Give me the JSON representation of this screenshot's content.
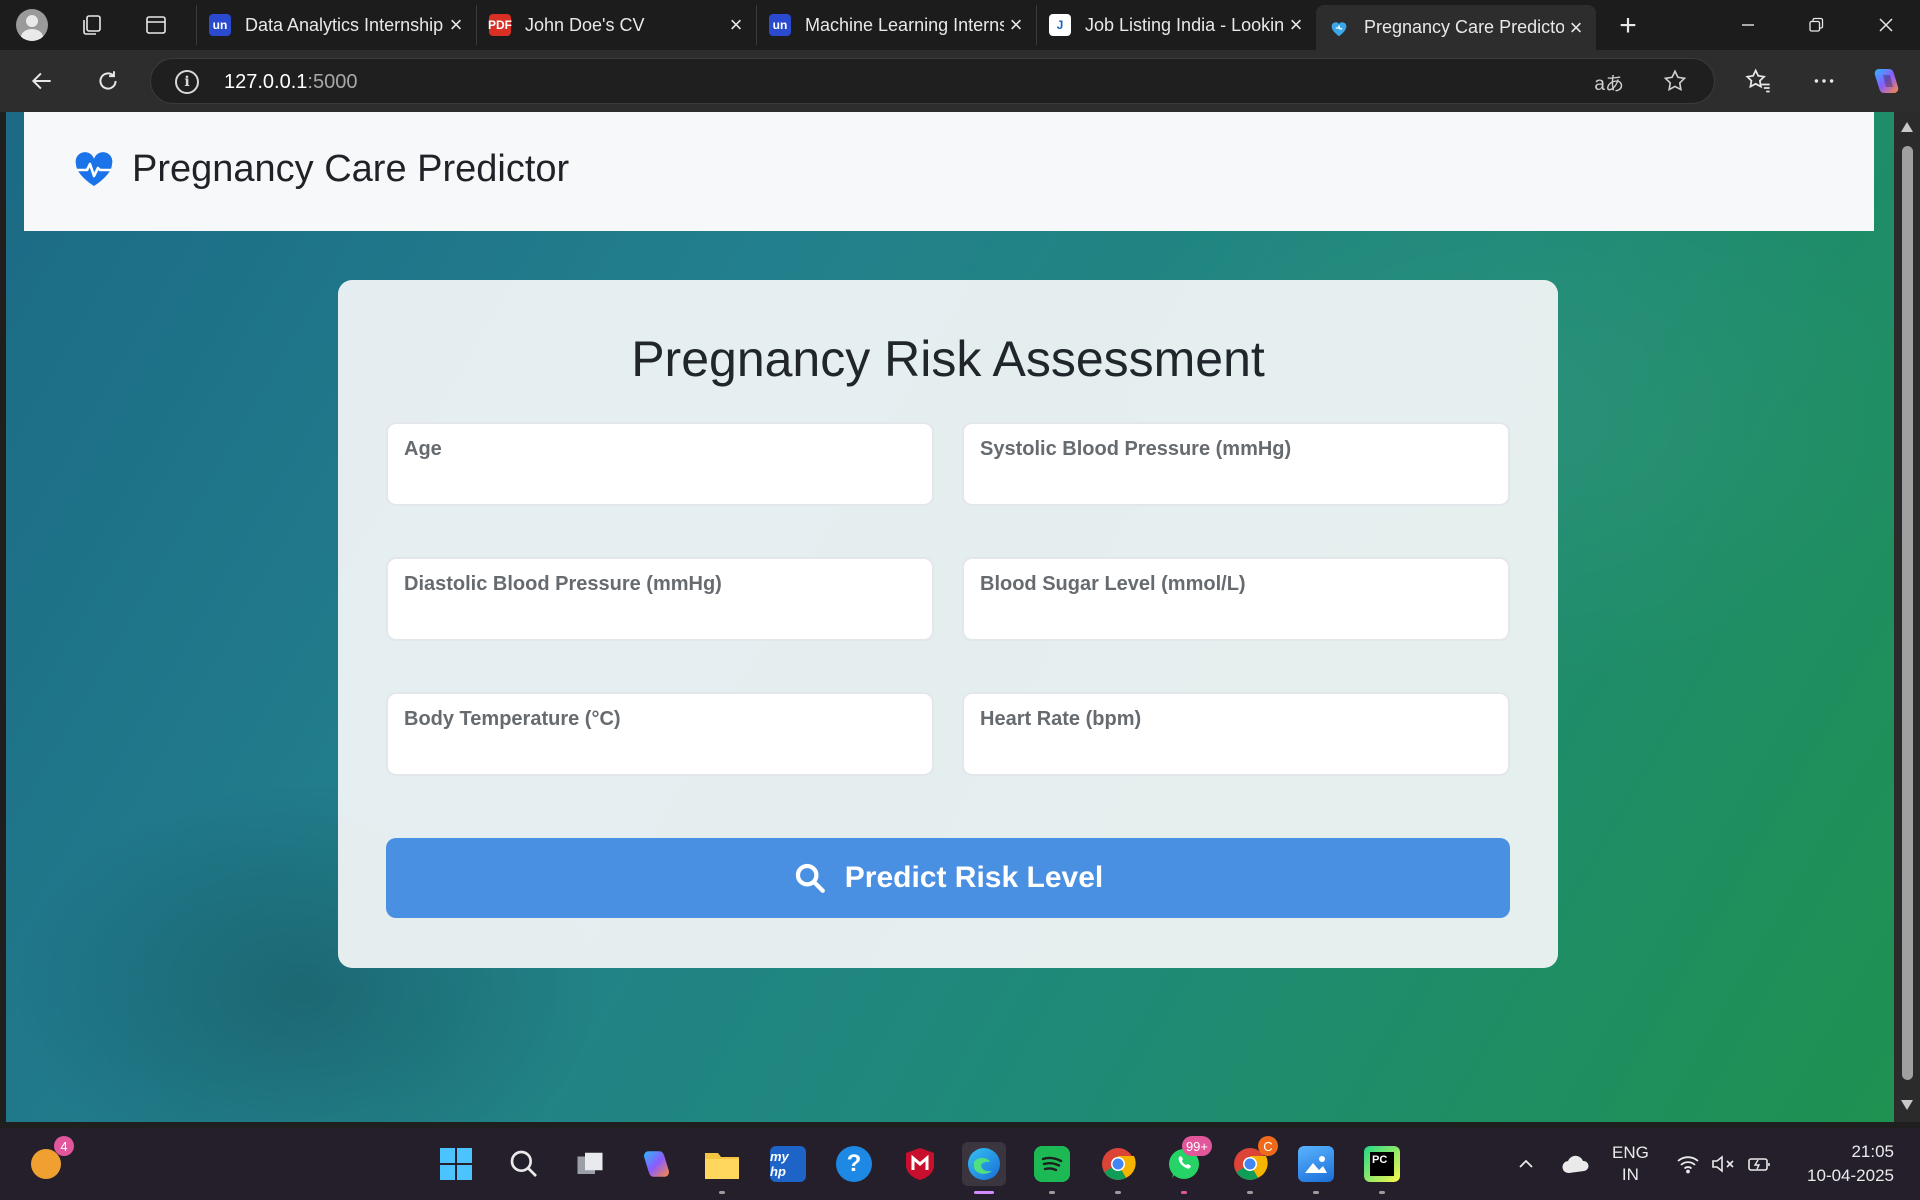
{
  "browser": {
    "tabs": [
      {
        "favicon": "un",
        "title": "Data Analytics Internship",
        "active": false
      },
      {
        "favicon": "PDF",
        "title": "John Doe's CV",
        "active": false
      },
      {
        "favicon": "un",
        "title": "Machine Learning Internship",
        "active": false
      },
      {
        "favicon": "J",
        "title": "Job Listing India - Looking",
        "active": false
      },
      {
        "favicon": "heart",
        "title": "Pregnancy Care Predictor",
        "active": true
      }
    ],
    "address": {
      "host": "127.0.0.1",
      "port": ":5000"
    },
    "read_aloud_label": "aあ"
  },
  "page": {
    "brand": "Pregnancy Care Predictor",
    "form": {
      "heading": "Pregnancy Risk Assessment",
      "fields": [
        {
          "label": "Age",
          "value": ""
        },
        {
          "label": "Systolic Blood Pressure (mmHg)",
          "value": ""
        },
        {
          "label": "Diastolic Blood Pressure (mmHg)",
          "value": ""
        },
        {
          "label": "Blood Sugar Level (mmol/L)",
          "value": ""
        },
        {
          "label": "Body Temperature (°C)",
          "value": ""
        },
        {
          "label": "Heart Rate (bpm)",
          "value": ""
        }
      ],
      "submit_label": "Predict Risk Level"
    },
    "colors": {
      "accent": "#4a90e2",
      "logo": "#1a73e8"
    }
  },
  "taskbar": {
    "widget_badge": "4",
    "whatsapp_badge": "99+",
    "chrome_profile_badge": "C",
    "language": {
      "line1": "ENG",
      "line2": "IN"
    },
    "clock": {
      "time": "21:05",
      "date": "10-04-2025"
    }
  }
}
